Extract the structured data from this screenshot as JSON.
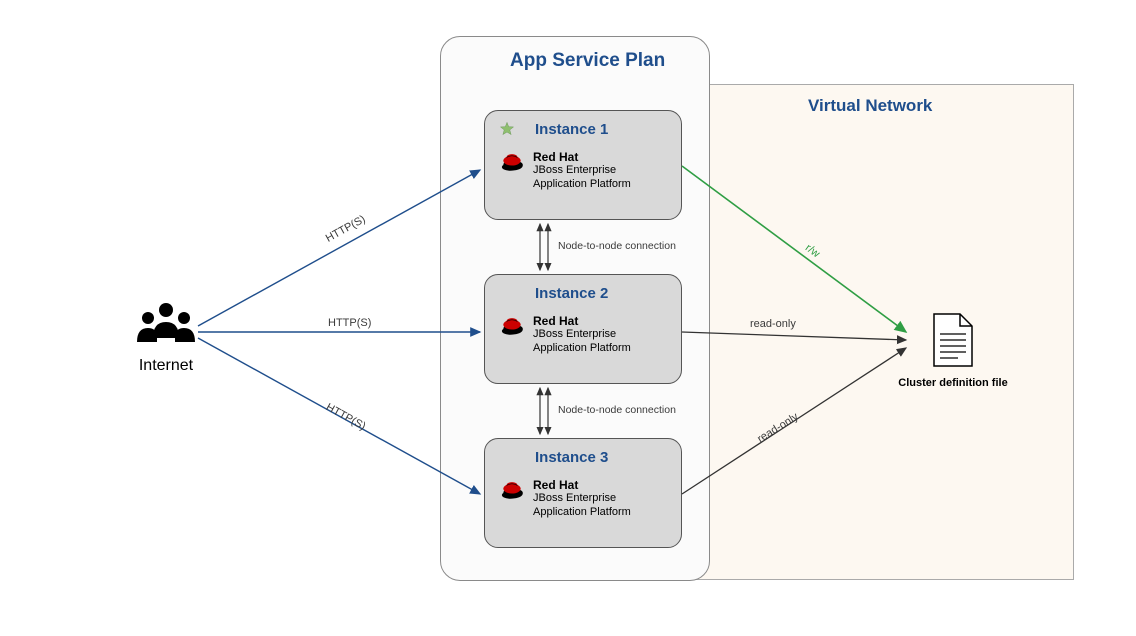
{
  "containers": {
    "app_service_plan": "App Service Plan",
    "virtual_network": "Virtual Network"
  },
  "internet": {
    "label": "Internet"
  },
  "cluster_file": {
    "label": "Cluster definition file"
  },
  "instances": [
    {
      "title": "Instance 1",
      "brand": "Red Hat",
      "line1": "JBoss Enterprise",
      "line2": "Application Platform",
      "starred": true
    },
    {
      "title": "Instance 2",
      "brand": "Red Hat",
      "line1": "JBoss Enterprise",
      "line2": "Application Platform",
      "starred": false
    },
    {
      "title": "Instance 3",
      "brand": "Red Hat",
      "line1": "JBoss Enterprise",
      "line2": "Application Platform",
      "starred": false
    }
  ],
  "edges": {
    "http_1": "HTTP(S)",
    "http_2": "HTTP(S)",
    "http_3": "HTTP(S)",
    "rw": "r/w",
    "ro_1": "read-only",
    "ro_2": "read-only",
    "node_conn_1": "Node-to-node connection",
    "node_conn_2": "Node-to-node connection"
  },
  "colors": {
    "blue": "#1f4e8c",
    "green": "#2f9e44",
    "redhat_red": "#cc0000",
    "star": "#8fbf6f"
  }
}
